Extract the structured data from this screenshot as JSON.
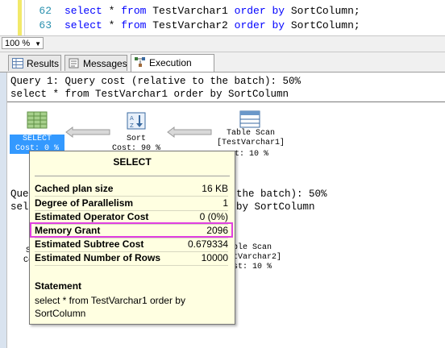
{
  "editor": {
    "lines": [
      {
        "num": "62",
        "kw1": "select",
        "mid1": " * ",
        "kw2": "from",
        "table": " TestVarchar1 ",
        "kw3": "order by",
        "rest": " SortColumn;"
      },
      {
        "num": "63",
        "kw1": "select",
        "mid1": " * ",
        "kw2": "from",
        "table": " TestVarchar2 ",
        "kw3": "order by",
        "rest": " SortColumn;"
      }
    ]
  },
  "zoom": {
    "value": "100 %"
  },
  "tabs": [
    {
      "label": "Results"
    },
    {
      "label": "Messages"
    },
    {
      "label": "Execution plan"
    }
  ],
  "plan": {
    "q1_header": "Query 1: Query cost (relative to the batch): 50%",
    "q1_sql": "select * from TestVarchar1 order by SortColumn",
    "q2_header_left": "Que",
    "q2_header_right": "the batch): 50%",
    "q2_sql_left": "sel",
    "q2_sql_right": "by SortColumn",
    "q1_nodes": {
      "select_l1": "SELECT",
      "select_l2": "Cost: 0 %",
      "sort_l1": "Sort",
      "sort_l2": "Cost: 90 %",
      "scan_l1": "Table Scan",
      "scan_l2": "[TestVarchar1]",
      "scan_l3": "ost: 10 %"
    },
    "q2_nodes": {
      "select_l1": "SE",
      "select_l2": "Cos",
      "scan_l1": "able Scan",
      "scan_l2": "stVarchar2]",
      "scan_l3": "ost: 10 %"
    }
  },
  "tooltip": {
    "title": "SELECT",
    "rows": [
      {
        "label": "Cached plan size",
        "value": "16 KB"
      },
      {
        "label": "Degree of Parallelism",
        "value": "1"
      },
      {
        "label": "Estimated Operator Cost",
        "value": "0 (0%)"
      },
      {
        "label": "Memory Grant",
        "value": "2096"
      },
      {
        "label": "Estimated Subtree Cost",
        "value": "0.679334"
      },
      {
        "label": "Estimated Number of Rows",
        "value": "10000"
      }
    ],
    "statement_label": "Statement",
    "statement_text": "select * from TestVarchar1 order by SortColumn"
  },
  "colors": {
    "keyword": "#0000ff",
    "line_number": "#2b91af",
    "tooltip_bg": "#ffffe1",
    "highlight": "#e040e0",
    "selected": "#3399ff"
  }
}
